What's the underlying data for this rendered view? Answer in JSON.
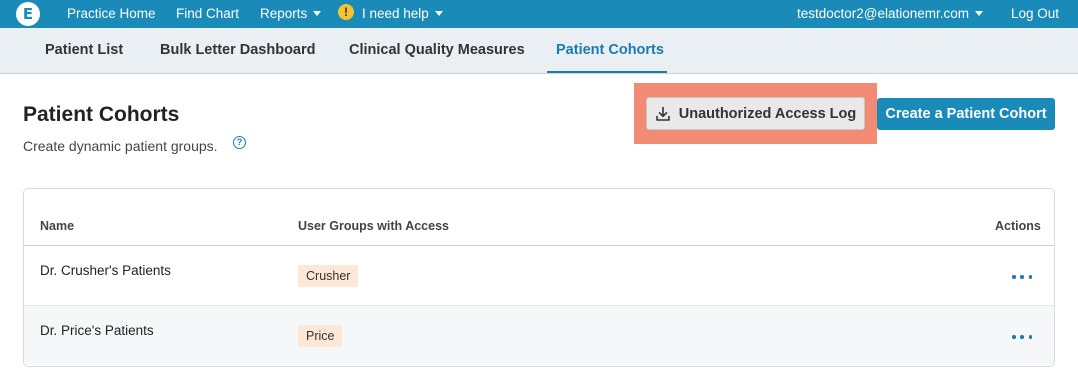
{
  "topnav": {
    "logo": "E",
    "practice_home": "Practice Home",
    "find_chart": "Find Chart",
    "reports": "Reports",
    "need_help": "I need help",
    "need_help_badge": "!",
    "user": "testdoctor2@elationemr.com",
    "logout": "Log Out"
  },
  "subnav": {
    "tabs": [
      {
        "label": "Patient List"
      },
      {
        "label": "Bulk Letter Dashboard"
      },
      {
        "label": "Clinical Quality Measures"
      },
      {
        "label": "Patient Cohorts",
        "active": true
      }
    ]
  },
  "header": {
    "title": "Patient Cohorts",
    "subtitle": "Create dynamic patient groups.",
    "help_glyph": "?",
    "log_button": "Unauthorized Access Log",
    "create_button": "Create a Patient Cohort"
  },
  "table": {
    "columns": [
      "Name",
      "User Groups with Access",
      "Actions"
    ],
    "rows": [
      {
        "name": "Dr. Crusher's Patients",
        "group": "Crusher"
      },
      {
        "name": "Dr. Price's Patients",
        "group": "Price"
      }
    ]
  },
  "colors": {
    "brand": "#1a8ab9",
    "highlight": "#f28b73",
    "pill": "#fde7d6"
  }
}
